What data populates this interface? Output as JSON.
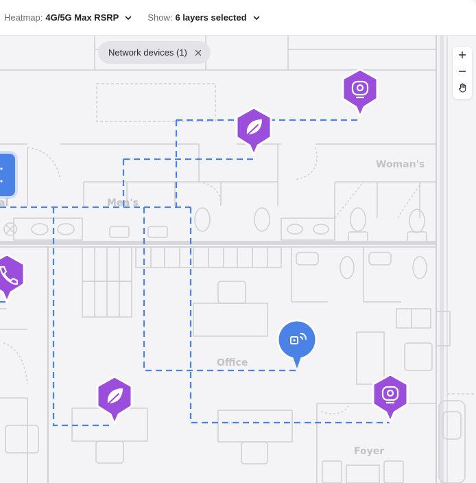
{
  "toolbar": {
    "heatmap_label": "Heatmap:",
    "heatmap_value": "4G/5G Max RSRP",
    "show_label": "Show:",
    "show_value": "6 layers selected"
  },
  "filter_chip": {
    "label": "Network devices (1)"
  },
  "zoom": {
    "zoom_in": "+",
    "zoom_out": "−"
  },
  "rooms": {
    "womens": "Woman's",
    "mens": "Men's",
    "office": "Office",
    "foyer": "Foyer",
    "partial": "al"
  },
  "devices": [
    {
      "type": "camera",
      "icon": "camera-icon",
      "color": "#9b4ddb"
    },
    {
      "type": "sensor",
      "icon": "leaf-icon",
      "color": "#9b4ddb"
    },
    {
      "type": "phone",
      "icon": "phone-icon",
      "color": "#9b4ddb"
    },
    {
      "type": "network-device",
      "icon": "router-icon",
      "color": "#4a82e6"
    },
    {
      "type": "sensor",
      "icon": "leaf-icon",
      "color": "#9b4ddb"
    },
    {
      "type": "camera",
      "icon": "camera-icon",
      "color": "#9b4ddb"
    }
  ],
  "colors": {
    "accent_purple": "#9b4ddb",
    "accent_blue": "#4a82e6",
    "connection_line": "#4a82e6"
  }
}
